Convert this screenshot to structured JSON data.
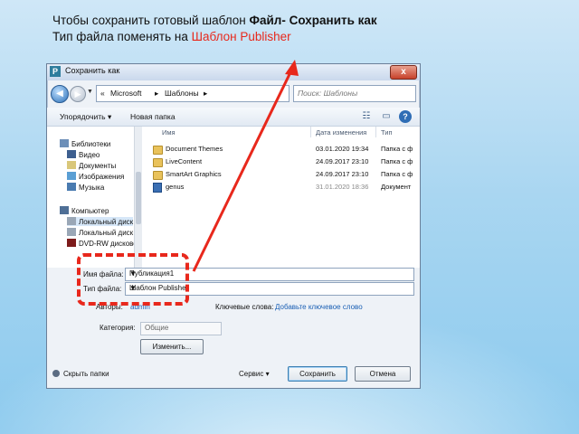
{
  "caption": {
    "line1_prefix": "Чтобы сохранить готовый шаблон ",
    "line1_bold": "Файл- Сохранить как",
    "line2_prefix": "Тип файла поменять на ",
    "line2_highlight": "Шаблон Publisher"
  },
  "colors": {
    "highlight": "#e8281c",
    "link": "#1a5fb4"
  },
  "dialog": {
    "title": "Сохранить как",
    "title_icon": "P",
    "close_label": "x",
    "breadcrumb": [
      "«",
      "Microsoft",
      "▸",
      "Шаблоны",
      "▸"
    ],
    "search_placeholder": "Поиск: Шаблоны",
    "toolbar": {
      "organize": "Упорядочить ▾",
      "new_folder": "Новая папка"
    },
    "nav_pane": [
      {
        "label": "Библиотеки",
        "icon": "libraries-icon"
      },
      {
        "label": "Видео",
        "icon": "video-icon"
      },
      {
        "label": "Документы",
        "icon": "documents-icon"
      },
      {
        "label": "Изображения",
        "icon": "pictures-icon"
      },
      {
        "label": "Музыка",
        "icon": "music-icon"
      },
      {
        "label": "Компьютер",
        "icon": "computer-icon"
      },
      {
        "label": "Локальный диск",
        "icon": "drive-icon"
      },
      {
        "label": "Локальный диск",
        "icon": "drive-icon"
      },
      {
        "label": "DVD-RW дисковод",
        "icon": "dvd-icon"
      }
    ],
    "columns": {
      "name": "Имя",
      "date": "Дата изменения",
      "type": "Тип"
    },
    "files": [
      {
        "name": "Document Themes",
        "date": "03.01.2020 19:34",
        "type": "Папка с ф",
        "kind": "folder"
      },
      {
        "name": "LiveContent",
        "date": "24.09.2017 23:10",
        "type": "Папка с ф",
        "kind": "folder"
      },
      {
        "name": "SmartArt Graphics",
        "date": "24.09.2017 23:10",
        "type": "Папка с ф",
        "kind": "folder"
      },
      {
        "name": "genus",
        "date": "31.01.2020 18:36",
        "type": "Документ",
        "kind": "doc"
      }
    ],
    "file_name_label": "Имя файла:",
    "file_name_value": "Публикация1",
    "file_type_label": "Тип файла:",
    "file_type_value": "Шаблон Publisher",
    "authors_label": "Авторы:",
    "authors_value": "admin",
    "keywords_label": "Ключевые слова:",
    "keywords_link": "Добавьте ключевое слово",
    "category_label": "Категория:",
    "category_value": "Общие",
    "change_button": "Изменить...",
    "hide_folders": "Скрыть папки",
    "service": "Сервис ▾",
    "save_button": "Сохранить",
    "cancel_button": "Отмена"
  }
}
